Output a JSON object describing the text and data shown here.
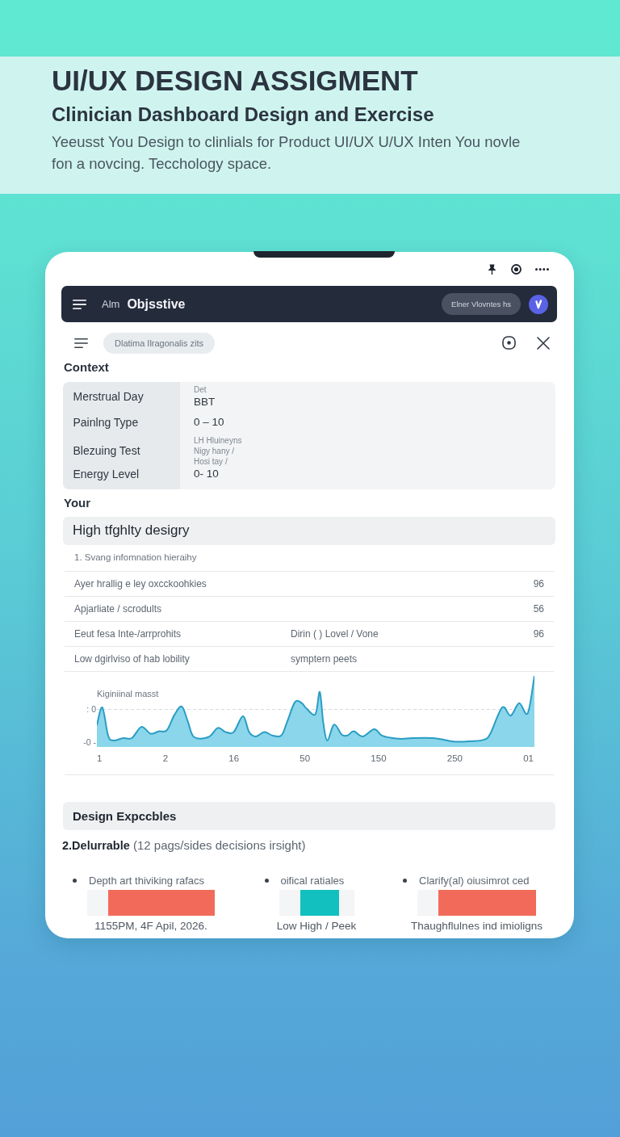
{
  "header": {
    "title": "UI/UX DESIGN ASSIGMENT",
    "subtitle": "Clinician Dashboard Design and Exercise",
    "description": "Yeeusst You Design to clinlials for Product UI/UX U/UX Inten You novle fon a novcing. Tecchology space."
  },
  "app_bar": {
    "prefix": "Alm",
    "title": "Objsstive",
    "chip": "Elner Vlovntes hs"
  },
  "toolbar": {
    "chip": "Dlatima Ilragonalis zits"
  },
  "context": {
    "heading": "Context",
    "rows": [
      {
        "label": "Merstrual Day",
        "values": [
          {
            "text": "Det",
            "kind": "caption"
          },
          {
            "text": "BBT",
            "kind": "value"
          }
        ]
      },
      {
        "label": "Painlng Type",
        "values": [
          {
            "text": "0 – 10",
            "kind": "value"
          }
        ]
      },
      {
        "label": "Blezuing Test",
        "values": [
          {
            "text": "LH Hluineyns",
            "kind": "caption"
          },
          {
            "text": "Nigy hany /",
            "kind": "caption"
          },
          {
            "text": "Hosi tay /",
            "kind": "caption"
          }
        ]
      },
      {
        "label": "Energy Level",
        "values": [
          {
            "text": "0- 10",
            "kind": "value"
          }
        ]
      }
    ]
  },
  "priorities": {
    "heading": "Your",
    "title": "High tfghlty desigry",
    "intro": "1. Svang infomnation hieraihy",
    "rows": [
      {
        "text": "Ayer hrallig e ley oxcckoohkies",
        "score": "96"
      },
      {
        "text": "Apjarliate / scrodults",
        "score": "56"
      },
      {
        "text": "Eeut fesa Inte-/arrprohits",
        "detail": "Dirin ( ) Lovel / Vone",
        "score": "96"
      },
      {
        "text": "Low dgirlviso of hab lobility",
        "detail": "symptern peets"
      }
    ]
  },
  "chart": {
    "title": "Kiginiinal masst",
    "y_labels": [
      ": 0",
      "-0 -"
    ],
    "x_labels": [
      "1",
      "2",
      "16",
      "50",
      "150",
      "250",
      "01"
    ]
  },
  "deliverables": {
    "heading": "Design Expccbles",
    "summary": "**2.Delurrable** (12 pags/sides decisions irsight)",
    "items": [
      {
        "text": "Depth art thiviking rafacs",
        "color": "#f26b5a",
        "caption": "1155PM, 4F Apil, 2026."
      },
      {
        "text": "oifical ratiales",
        "color": "#12c0bf",
        "caption": "Low High / Peek"
      },
      {
        "text": "Clarify(al) oiusimrot ced",
        "color": "#f26b5a",
        "caption": "Thaughflulnes ind imioligns"
      }
    ]
  }
}
